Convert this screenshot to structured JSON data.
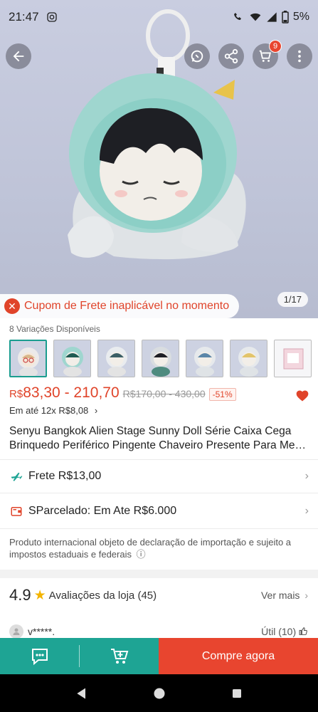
{
  "status_bar": {
    "time": "21:47",
    "battery": "5%"
  },
  "hero": {
    "page_indicator": "1/17",
    "cart_badge": "9"
  },
  "coupon": {
    "text": "Cupom de Frete inaplicável no momento"
  },
  "variations": {
    "label": "8 Variações Disponíveis",
    "count_shown": 8
  },
  "price": {
    "currency": "R$",
    "range": "83,30 - 210,70",
    "old": "R$170,00 - 430,00",
    "discount": "-51%",
    "installment": "Em até 12x R$8,08",
    "installment_chevron": "›"
  },
  "product": {
    "title_line1": "Senyu Bangkok Alien Stage Sunny Doll Série Caixa Cega",
    "title_line2": "Brinquedo Periférico Pingente Chaveiro Presente Para Me…"
  },
  "shipping": {
    "label": "Frete R$13,00",
    "chevron": "›"
  },
  "installments_row": {
    "label": "SParcelado: Em Ate R$6.000",
    "chevron": "›"
  },
  "notice": {
    "text": "Produto internacional objeto de declaração de importação e sujeito a impostos estaduais e federais",
    "info_icon": "ⓘ"
  },
  "store_rating": {
    "value": "4.9",
    "star": "★",
    "label": "Avaliações da loja (45)",
    "see_more": "Ver mais",
    "chevron": "›"
  },
  "review": {
    "user": "v*****.",
    "useful": "Útil (10)"
  },
  "actions": {
    "buy": "Compre agora"
  },
  "icons": {
    "back": "arrow-left-icon",
    "whatsapp": "whatsapp-icon",
    "share": "share-icon",
    "cart": "cart-icon",
    "more": "more-vertical-icon"
  },
  "colors": {
    "accent": "#1ea494",
    "brand_red": "#e8452f",
    "price_red": "#e0442a"
  }
}
